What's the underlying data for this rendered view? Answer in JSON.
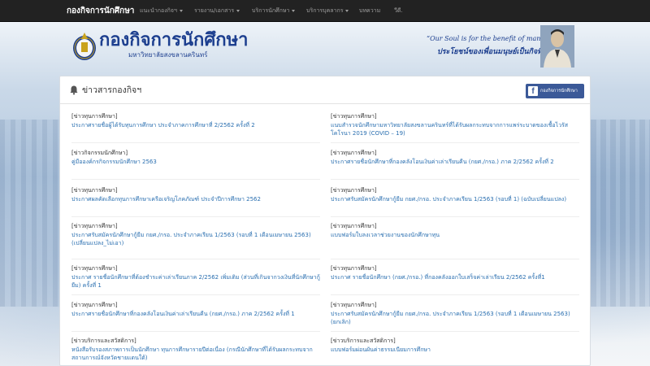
{
  "navbar": {
    "brand": "กองกิจการนักศึกษา",
    "items": [
      {
        "label": "แนะนำกองกิจฯ",
        "dropdown": true
      },
      {
        "label": "รายงาน/เอกสาร",
        "dropdown": true
      },
      {
        "label": "บริการนักศึกษา",
        "dropdown": true
      },
      {
        "label": "บริการบุคลากร",
        "dropdown": true
      },
      {
        "label": "บทความ",
        "dropdown": false
      },
      {
        "label": "วีดี.",
        "dropdown": false
      }
    ]
  },
  "header": {
    "logo_title": "กองกิจการนักศึกษา",
    "logo_subtitle": "มหาวิทยาลัยสงขลานครินทร์",
    "motto_en": "“Our Soul is for the benefit of mankind",
    "motto_th": "ประโยชน์ของเพื่อนมนุษย์เป็นกิจที่หนึ่ง”"
  },
  "panel": {
    "title": "ข่าวสารกองกิจฯ",
    "fb_label": "กองกิจการนักศึกษา",
    "fb_icon": "f"
  },
  "news": [
    {
      "category": "[ข่าวทุนการศึกษา]",
      "title": "ประกาศรายชื่อผู้ได้รับทุนการศึกษา ประจำภาคการศึกษาที่ 2/2562 ครั้งที่ 2"
    },
    {
      "category": "[ข่าวทุนการศึกษา]",
      "title": "แนบสำรวจนักศึกษามหาวิทยาลัยสงขลานครินทร์ที่ได้รับผลกระทบจากการแพร่ระบาดของเชื้อไวรัสโคโรนา 2019 (COVID – 19)"
    },
    {
      "category": "[ข่าวกิจกรรมนักศึกษา]",
      "title": "คู่มือองค์กรกิจกรรมนักศึกษา 2563"
    },
    {
      "category": "[ข่าวทุนการศึกษา]",
      "title": "ประกาศรายชื่อนักศึกษาที่กองคลังโอนเงินค่าเล่าเรียนคืน (กยศ./กรอ.) ภาค 2/2562 ครั้งที่ 2"
    },
    {
      "category": "[ข่าวทุนการศึกษา]",
      "title": "ประกาศผลคัดเลือกทุนการศึกษาเครือเจริญโภคภัณฑ์ ประจำปีการศึกษา 2562"
    },
    {
      "category": "[ข่าวทุนการศึกษา]",
      "title": "ประกาศรับสมัครนักศึกษากู้ยืม กยศ./กรอ. ประจำภาคเรียน 1/2563 (รอบที่ 1) (ฉบับเปลี่ยนแปลง)"
    },
    {
      "category": "[ข่าวทุนการศึกษา]",
      "title": "ประกาศรับสมัครนักศึกษากู้ยืม กยศ./กรอ. ประจำภาคเรียน 1/2563 (รอบที่ 1 เดือนเมษายน 2563) (เปลี่ยนแปลง_ไม่เอา)"
    },
    {
      "category": "[ข่าวทุนการศึกษา]",
      "title": "แบบฟอร์มใบลงเวลาช่วยงานของนักศึกษาทุน"
    },
    {
      "category": "[ข่าวทุนการศึกษา]",
      "title": "ประกาศ รายชื่อนักศึกษาที่ต้องชำระค่าเล่าเรียนภาค 2/2562 เพิ่มเติม (ส่วนที่เกินจากวงเงินที่นักศึกษากู้ยืม) ครั้งที่ 1"
    },
    {
      "category": "[ข่าวทุนการศึกษา]",
      "title": "ประกาศ รายชื่อนักศึกษา (กยศ./กรอ.) ที่กองคลังออกใบเสร็จค่าเล่าเรียน 2/2562 ครั้งที่1"
    },
    {
      "category": "[ข่าวทุนการศึกษา]",
      "title": "ประกาศรายชื่อนักศึกษาที่กองคลังโอนเงินค่าเล่าเรียนคืน (กยศ./กรอ.) ภาค 2/2562 ครั้งที่ 1"
    },
    {
      "category": "[ข่าวทุนการศึกษา]",
      "title": "ประกาศรับสมัครนักศึกษากู้ยืม กยศ./กรอ. ประจำภาคเรียน 1/2563 (รอบที่ 1 เดือนเมษายน 2563) (ยกเลิก)"
    },
    {
      "category": "[ข่าวบริการและสวัสดิการ]",
      "title": "หนังสือรับรองสภาพการเป็นนักศึกษา ทุนการศึกษารายปีต่อเนื่อง (กรณีนักศึกษาที่ได้รับผลกระทบจากสถานการณ์จังหวัดชายแดนใต้)"
    },
    {
      "category": "[ข่าวบริการและสวัสดิการ]",
      "title": "แบบฟอร์มผ่อนผันค่าธรรมเนียมการศึกษา"
    }
  ]
}
